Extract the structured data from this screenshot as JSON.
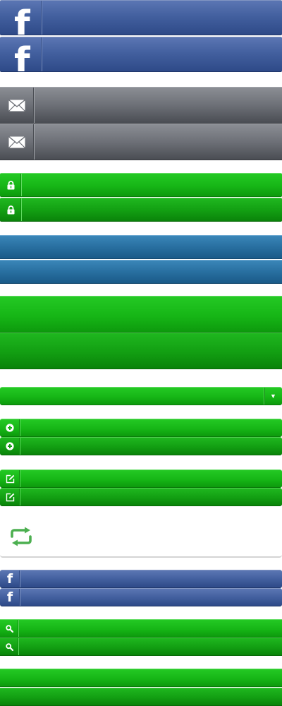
{
  "icons": {
    "facebook_glyph": "f",
    "dropdown_glyph": "▼",
    "names": [
      "facebook-icon",
      "mail-icon",
      "lock-icon",
      "plus-circle-icon",
      "edit-icon",
      "retweet-icon",
      "search-icon",
      "chevron-down-icon"
    ]
  },
  "colors": {
    "facebook_blue": "#3b5998",
    "mail_gray": "#6d7077",
    "green": "#16b616",
    "steel_blue": "#286fa0",
    "retweet_green": "#4caf50"
  }
}
